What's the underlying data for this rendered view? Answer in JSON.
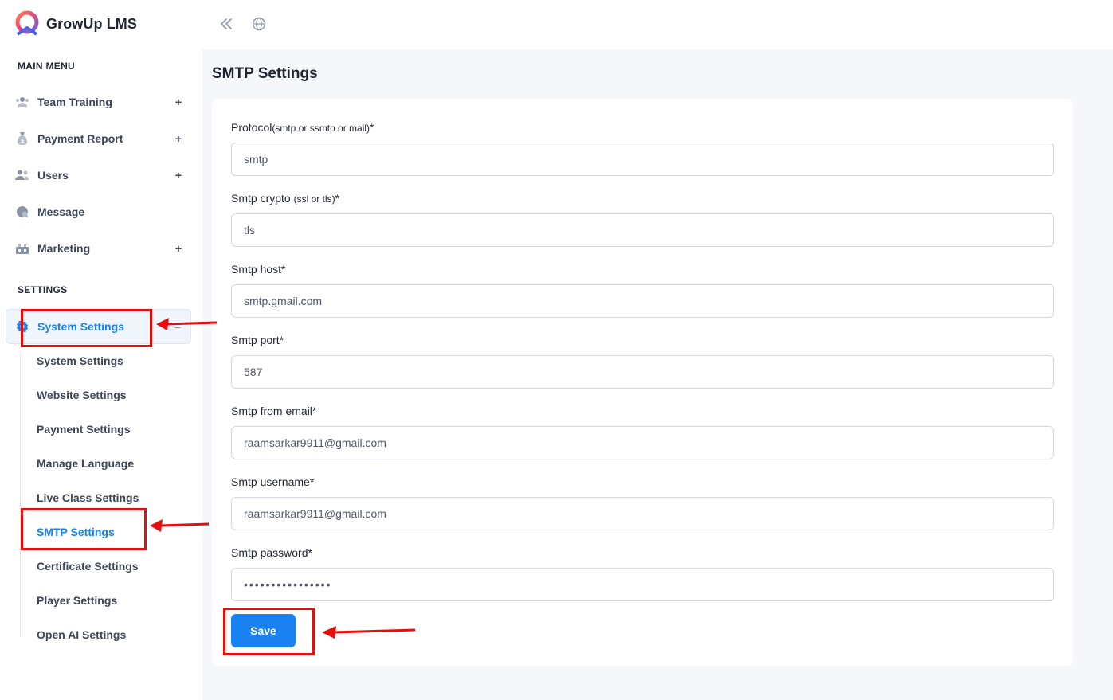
{
  "brand": {
    "name": "GrowUp LMS"
  },
  "sidebar": {
    "main_menu_title": "MAIN MENU",
    "main_items": [
      {
        "label": "Team Training",
        "icon": "team-icon",
        "expand": "+"
      },
      {
        "label": "Payment Report",
        "icon": "money-bag-icon",
        "expand": "+"
      },
      {
        "label": "Users",
        "icon": "users-icon",
        "expand": "+"
      },
      {
        "label": "Message",
        "icon": "message-icon",
        "expand": ""
      },
      {
        "label": "Marketing",
        "icon": "marketing-icon",
        "expand": "+"
      }
    ],
    "settings_title": "SETTINGS",
    "settings_item": {
      "label": "System Settings",
      "icon": "gear-icon",
      "expand": "–"
    },
    "sub_items": [
      {
        "label": "System Settings"
      },
      {
        "label": "Website Settings"
      },
      {
        "label": "Payment Settings"
      },
      {
        "label": "Manage Language"
      },
      {
        "label": "Live Class Settings"
      },
      {
        "label": "SMTP Settings",
        "active": true
      },
      {
        "label": "Certificate Settings"
      },
      {
        "label": "Player Settings"
      },
      {
        "label": "Open AI Settings"
      }
    ]
  },
  "topbar": {
    "icons": [
      "collapse-sidebar-icon",
      "globe-icon"
    ]
  },
  "main": {
    "title": "SMTP Settings",
    "form": {
      "protocol": {
        "label": "Protocol",
        "hint": "(smtp or ssmtp or mail)",
        "required": "*",
        "value": "smtp"
      },
      "crypto": {
        "label": "Smtp crypto ",
        "hint": "(ssl or tls)",
        "required": "*",
        "value": "tls"
      },
      "host": {
        "label": "Smtp host",
        "required": "*",
        "value": "smtp.gmail.com"
      },
      "port": {
        "label": "Smtp port",
        "required": "*",
        "value": "587"
      },
      "from_email": {
        "label": "Smtp from email",
        "required": "*",
        "value": "raamsarkar9911@gmail.com"
      },
      "username": {
        "label": "Smtp username",
        "required": "*",
        "value": "raamsarkar9911@gmail.com"
      },
      "password": {
        "label": "Smtp password",
        "required": "*",
        "value": "••••••••••••••••"
      }
    },
    "save_label": "Save"
  },
  "annotations": {
    "color": "#e60d0d"
  },
  "colors": {
    "accent": "#1a82f0",
    "background": "#f5f7fb"
  }
}
